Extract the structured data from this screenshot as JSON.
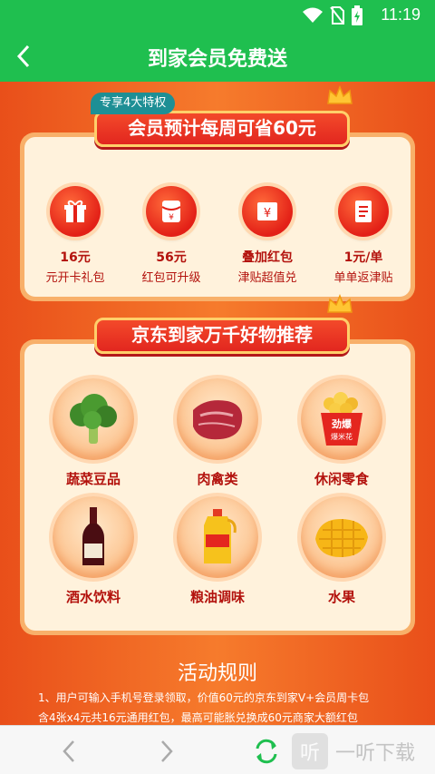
{
  "status": {
    "time": "11:19"
  },
  "header": {
    "title": "到家会员免费送"
  },
  "perks_section": {
    "tag": "专享4大特权",
    "banner": "会员预计每周可省60元",
    "items": [
      {
        "icon": "gift-icon",
        "title": "16元",
        "subtitle": "元开卡礼包"
      },
      {
        "icon": "red-envelope-icon",
        "title": "56元",
        "subtitle": "红包可升级"
      },
      {
        "icon": "coupon-icon",
        "title": "叠加红包",
        "subtitle": "津贴超值兑"
      },
      {
        "icon": "receipt-icon",
        "title": "1元/单",
        "subtitle": "单单返津贴"
      }
    ]
  },
  "goods_section": {
    "banner": "京东到家万千好物推荐",
    "items": [
      {
        "icon": "broccoli-icon",
        "label": "蔬菜豆品"
      },
      {
        "icon": "meat-icon",
        "label": "肉禽类"
      },
      {
        "icon": "popcorn-icon",
        "label": "休闲零食"
      },
      {
        "icon": "wine-bottle-icon",
        "label": "酒水饮料"
      },
      {
        "icon": "oil-bottle-icon",
        "label": "粮油调味"
      },
      {
        "icon": "mango-icon",
        "label": "水果"
      }
    ],
    "popcorn_text": "劲爆\n爆米花"
  },
  "rules": {
    "title": "活动规则",
    "line1": "1、用户可输入手机号登录领取，价值60元的京东到家V+会员周卡包",
    "line2": "含4张x4元共16元通用红包，最高可能胀兑换成60元商家大额红包"
  },
  "watermark": {
    "box": "听",
    "text": "一听下载"
  },
  "colors": {
    "accent": "#1fbf4f",
    "orange": "#f06a1f",
    "red": "#e2261f"
  }
}
